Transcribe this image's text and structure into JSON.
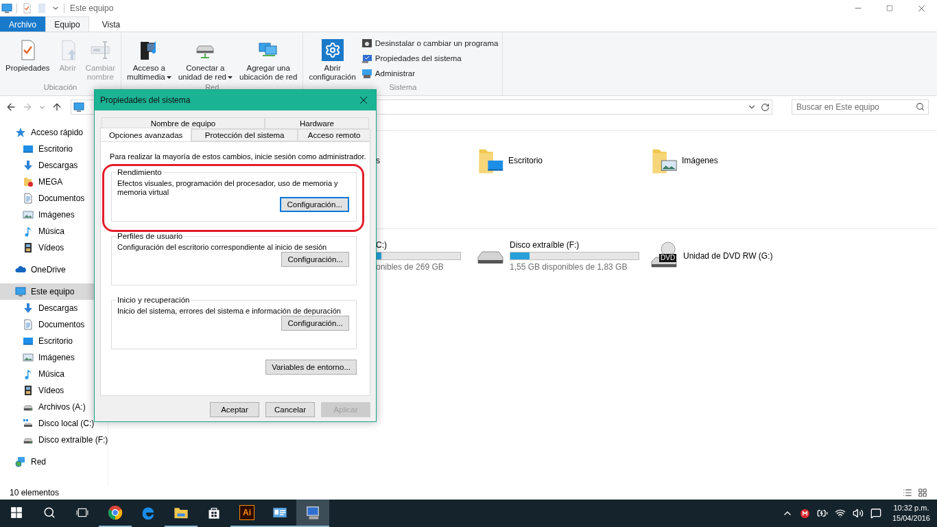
{
  "window": {
    "title": "Este equipo"
  },
  "ribbon_tabs": [
    {
      "label": "Archivo",
      "kind": "file",
      "selected": false
    },
    {
      "label": "Equipo",
      "kind": "tab",
      "selected": true
    },
    {
      "label": "Vista",
      "kind": "tab",
      "selected": false
    }
  ],
  "ribbon_groups": [
    {
      "label": "Ubicación",
      "large": [
        {
          "label": [
            "Propiedades"
          ],
          "kind": "properties",
          "disabled": false,
          "dropdown": false
        },
        {
          "label": [
            "Abrir"
          ],
          "kind": "open",
          "disabled": true,
          "dropdown": false
        },
        {
          "label": [
            "Cambiar",
            "nombre"
          ],
          "kind": "rename",
          "disabled": true,
          "dropdown": false
        }
      ]
    },
    {
      "label": "Red",
      "large": [
        {
          "label": [
            "Acceso a",
            "multimedia"
          ],
          "kind": "media",
          "disabled": false,
          "dropdown": true
        },
        {
          "label": [
            "Conectar a",
            "unidad de red"
          ],
          "kind": "netdrive",
          "disabled": false,
          "dropdown": true
        },
        {
          "label": [
            "Agregar una",
            "ubicación de red"
          ],
          "kind": "netlocation",
          "disabled": false,
          "dropdown": false
        }
      ]
    },
    {
      "label": "Sistema",
      "large": [
        {
          "label": [
            "Abrir",
            "configuración"
          ],
          "kind": "settings",
          "disabled": false,
          "dropdown": false
        }
      ],
      "small": [
        {
          "label": "Desinstalar o cambiar un programa",
          "kind": "uninstall"
        },
        {
          "label": "Propiedades del sistema",
          "kind": "sysprops"
        },
        {
          "label": "Administrar",
          "kind": "admin"
        }
      ]
    }
  ],
  "address_bar": {
    "search_placeholder": "Buscar en Este equipo"
  },
  "sidebar": {
    "items": [
      {
        "label": "Acceso rápido",
        "kind": "star",
        "selected": false,
        "children": [
          {
            "label": "Escritorio",
            "kind": "desktop",
            "selected": false
          },
          {
            "label": "Descargas",
            "kind": "download",
            "selected": false
          },
          {
            "label": "MEGA",
            "kind": "mega",
            "selected": false
          },
          {
            "label": "Documentos",
            "kind": "document",
            "selected": false
          },
          {
            "label": "Imágenes",
            "kind": "pictures",
            "selected": false
          },
          {
            "label": "Música",
            "kind": "music",
            "selected": false
          },
          {
            "label": "Vídeos",
            "kind": "video",
            "selected": false
          }
        ]
      },
      {
        "label": "OneDrive",
        "kind": "cloud",
        "selected": false
      },
      {
        "label": "Este equipo",
        "kind": "computer",
        "selected": true,
        "children": [
          {
            "label": "Descargas",
            "kind": "download",
            "selected": false
          },
          {
            "label": "Documentos",
            "kind": "document",
            "selected": false
          },
          {
            "label": "Escritorio",
            "kind": "desktop",
            "selected": false
          },
          {
            "label": "Imágenes",
            "kind": "pictures",
            "selected": false
          },
          {
            "label": "Música",
            "kind": "music",
            "selected": false
          },
          {
            "label": "Vídeos",
            "kind": "video",
            "selected": false
          },
          {
            "label": "Archivos  (A:)",
            "kind": "drive",
            "selected": false
          },
          {
            "label": "Disco local (C:)",
            "kind": "drivewin",
            "selected": false
          },
          {
            "label": "Disco extraíble (F:)",
            "kind": "drive",
            "selected": false
          }
        ]
      },
      {
        "label": "Red",
        "kind": "network",
        "selected": false
      }
    ]
  },
  "folders": [
    {
      "label": "s",
      "kind": "partial"
    },
    {
      "label": "Escritorio",
      "kind": "desktop"
    },
    {
      "label": "Imágenes",
      "kind": "pictures"
    }
  ],
  "drives": [
    {
      "name": "C:)",
      "kind": "partial",
      "level": 0.06,
      "free": "onibles de 269 GB"
    },
    {
      "name": "Disco extraíble (F:)",
      "kind": "drive",
      "level": 0.15,
      "free": "1,55 GB disponibles de 1,83 GB"
    },
    {
      "name": "Unidad de DVD RW (G:)",
      "kind": "dvd",
      "badge": "DVD"
    }
  ],
  "status_bar": {
    "count": "10 elementos"
  },
  "dialog": {
    "title": "Propiedades del sistema",
    "tab_rows": [
      [
        {
          "label": "Nombre de equipo",
          "selected": false
        },
        {
          "label": "Hardware",
          "selected": false
        }
      ],
      [
        {
          "label": "Opciones avanzadas",
          "selected": true
        },
        {
          "label": "Protección del sistema",
          "selected": false
        },
        {
          "label": "Acceso remoto",
          "selected": false
        }
      ]
    ],
    "notice": "Para realizar la mayoría de estos cambios, inicie sesión como administrador.",
    "groups": [
      {
        "title": "Rendimiento",
        "description": "Efectos visuales, programación del procesador, uso de memoria y memoria virtual",
        "button": "Configuración...",
        "focused": true
      },
      {
        "title": "Perfiles de usuario",
        "description": "Configuración del escritorio correspondiente al inicio de sesión",
        "button": "Configuración...",
        "focused": false
      },
      {
        "title": "Inicio y recuperación",
        "description": "Inicio del sistema, errores del sistema e información de depuración",
        "button": "Configuración...",
        "focused": false
      }
    ],
    "env_button": "Variables de entorno...",
    "buttons": [
      {
        "label": "Aceptar",
        "disabled": false
      },
      {
        "label": "Cancelar",
        "disabled": false
      },
      {
        "label": "Aplicar",
        "disabled": true
      }
    ]
  },
  "taskbar": {
    "apps": [
      {
        "kind": "start",
        "open": false,
        "selected": false
      },
      {
        "kind": "search",
        "open": false,
        "selected": false
      },
      {
        "kind": "taskview",
        "open": false,
        "selected": false
      },
      {
        "kind": "chrome",
        "open": true,
        "selected": false
      },
      {
        "kind": "edge",
        "open": false,
        "selected": false
      },
      {
        "kind": "explorer",
        "open": true,
        "selected": false
      },
      {
        "kind": "store",
        "open": false,
        "selected": false
      },
      {
        "kind": "illustrator",
        "label": "Ai",
        "open": true,
        "selected": false
      },
      {
        "kind": "outlook",
        "open": true,
        "selected": false
      },
      {
        "kind": "sysprops",
        "open": true,
        "selected": true
      }
    ],
    "tray": [
      {
        "kind": "chevron"
      },
      {
        "kind": "mega"
      },
      {
        "kind": "power"
      },
      {
        "kind": "wifi"
      },
      {
        "kind": "volume"
      },
      {
        "kind": "notifications"
      }
    ],
    "time": "10:32 p.m.",
    "date": "15/04/2016"
  }
}
